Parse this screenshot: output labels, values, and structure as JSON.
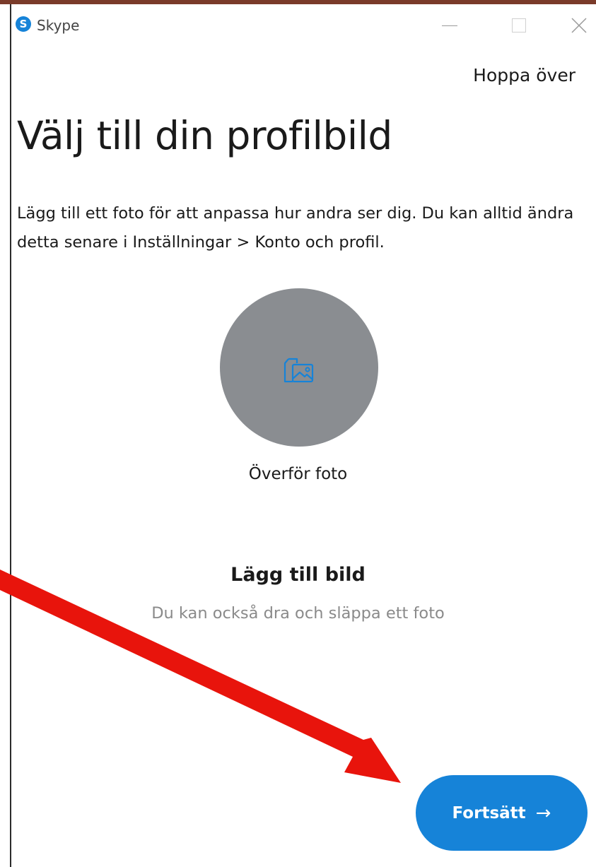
{
  "window": {
    "app_title": "Skype",
    "logo_letter": "S",
    "controls": [
      "minimize",
      "maximize",
      "close"
    ]
  },
  "header": {
    "skip_label": "Hoppa över"
  },
  "main": {
    "heading": "Välj till din profilbild",
    "description": "Lägg till ett foto för att anpassa hur andra ser dig. Du kan alltid ändra detta senare i Inställningar > Konto och profil.",
    "upload_label": "Överför foto",
    "add_title": "Lägg till bild",
    "add_subtitle": "Du kan också dra och släppa ett foto"
  },
  "footer": {
    "continue_label": "Fortsätt",
    "continue_arrow": "→"
  },
  "icons": {
    "app_logo": "skype-logo-icon",
    "upload": "image-upload-icon",
    "annotation": "red-arrow-annotation"
  },
  "colors": {
    "accent": "#1683d8",
    "avatar_bg": "#8a8d91",
    "annotation": "#e8140c",
    "text": "#1a1a1a",
    "muted": "#8a8a8a"
  }
}
